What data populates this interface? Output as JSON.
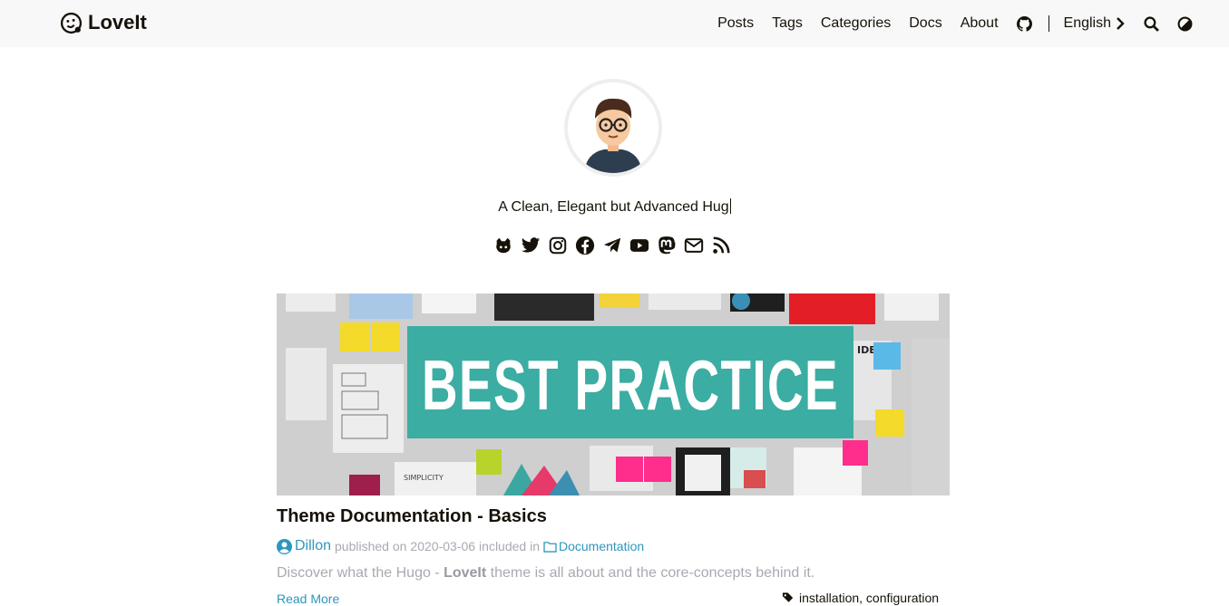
{
  "header": {
    "logo_text": "LoveIt",
    "nav": [
      "Posts",
      "Tags",
      "Categories",
      "Docs",
      "About"
    ],
    "language": "English",
    "icons": [
      "github-icon",
      "search-icon",
      "theme-toggle-icon"
    ]
  },
  "profile": {
    "subtitle": "A Clean, Elegant but Advanced Hug",
    "social_icons": [
      "github-icon",
      "twitter-icon",
      "instagram-icon",
      "facebook-icon",
      "telegram-icon",
      "youtube-icon",
      "mastodon-icon",
      "email-icon",
      "rss-icon"
    ]
  },
  "featured_image": {
    "text": "BEST PRACTICE",
    "caption_small": "SIMPLICITY",
    "side_text": "IDEA"
  },
  "post": {
    "title": "Theme Documentation - Basics",
    "author": "Dillon",
    "published_prefix": "published on",
    "date": "2020-03-06",
    "included_in": "included in",
    "category": "Documentation",
    "summary_before": "Discover what the Hugo - ",
    "summary_bold": "LoveIt",
    "summary_after": " theme is all about and the core-concepts behind it.",
    "read_more": "Read More",
    "tags": "installation, configuration"
  },
  "colors": {
    "accent": "#2d96bd",
    "text": "#161209",
    "muted": "#a9a9b3",
    "header_bg": "#f8f8f8",
    "banner": "#3bada3"
  }
}
